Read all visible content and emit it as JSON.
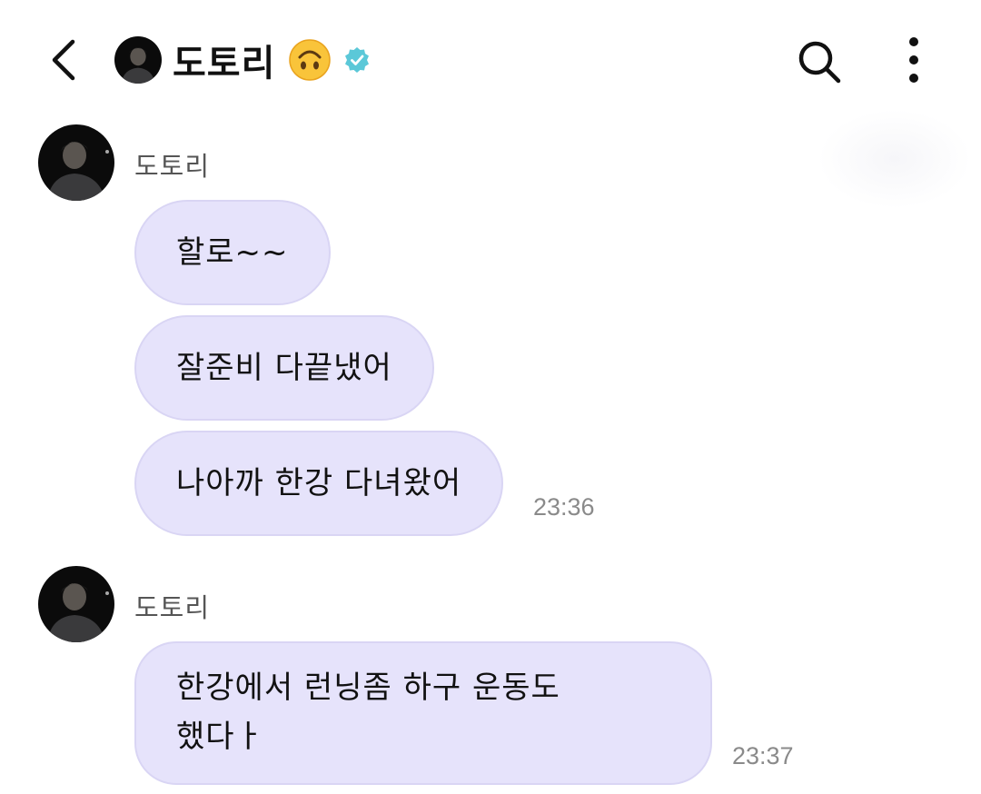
{
  "header": {
    "contact_name": "도토리",
    "icons": [
      "back-arrow-icon",
      "profile-avatar",
      "upside-down-face-emoji",
      "verified-badge-icon",
      "search-icon",
      "more-vertical-icon"
    ],
    "verified_color": "#5bc8d8"
  },
  "groups": [
    {
      "sender": "도토리",
      "messages": [
        {
          "text": "할로~~"
        },
        {
          "text": "잘준비 다끝냈어"
        },
        {
          "text": "나아까 한강 다녀왔어",
          "time": "23:36"
        }
      ]
    },
    {
      "sender": "도토리",
      "messages": [
        {
          "line1": "한강에서 런닝좀 하구 운동도",
          "line2": "했다ㅏ",
          "time": "23:37"
        }
      ]
    }
  ],
  "colors": {
    "bubble": "#e6e3fb",
    "bubble_border": "#d9d5f4",
    "timestamp": "#8a8a8a",
    "sender_name": "#555555"
  }
}
